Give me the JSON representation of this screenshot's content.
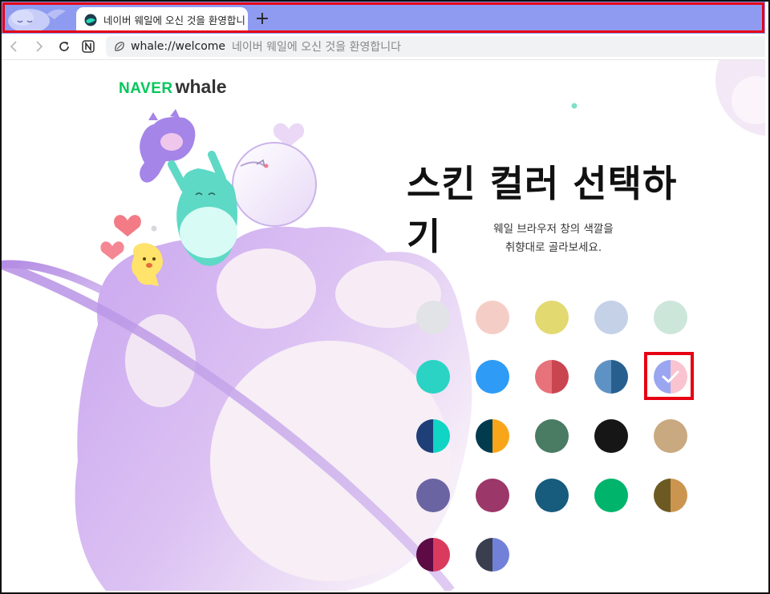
{
  "browser": {
    "tab_title": "네이버 웨일에 오신 것을 환영합니다",
    "new_tab_label": "+",
    "accent_color": "#8f9bf0"
  },
  "address_bar": {
    "url": "whale://welcome",
    "page_name": "네이버 웨일에 오신 것을 환영합니다"
  },
  "page": {
    "logo_naver": "NAVER",
    "logo_whale": "whale",
    "headline": "스킨 컬러 선택하기",
    "subtitle_line1": "웨일 브라우저 창의 색깔을",
    "subtitle_line2": "취향대로 골라보세요.",
    "selected_swatch_index": 9,
    "swatches": [
      {
        "left": "#e1e3e7",
        "right": "#e1e3e7"
      },
      {
        "left": "#f4cec6",
        "right": "#f4cec6"
      },
      {
        "left": "#e2d971",
        "right": "#e2d971"
      },
      {
        "left": "#c5d1e7",
        "right": "#c5d1e7"
      },
      {
        "left": "#cde6da",
        "right": "#cde6da"
      },
      {
        "left": "#2ad3c3",
        "right": "#2ad3c3"
      },
      {
        "left": "#2e9bf6",
        "right": "#2e9bf6"
      },
      {
        "left": "#e7727a",
        "right": "#c94651"
      },
      {
        "left": "#5f92c4",
        "right": "#27608f"
      },
      {
        "left": "#9aa6ef",
        "right": "#f9c3cf"
      },
      {
        "left": "#1e3f78",
        "right": "#10d4c4"
      },
      {
        "left": "#023b4e",
        "right": "#f9a51a"
      },
      {
        "left": "#4a7b63",
        "right": "#4a7b63"
      },
      {
        "left": "#161616",
        "right": "#161616"
      },
      {
        "left": "#c9a97f",
        "right": "#c9a97f"
      },
      {
        "left": "#6b64a3",
        "right": "#6b64a3"
      },
      {
        "left": "#9c376a",
        "right": "#9c376a"
      },
      {
        "left": "#175b7d",
        "right": "#175b7d"
      },
      {
        "left": "#00b46c",
        "right": "#00b46c"
      },
      {
        "left": "#6c5a22",
        "right": "#cb9550"
      },
      {
        "left": "#5d0a45",
        "right": "#d93a5e"
      },
      {
        "left": "#3a3f4f",
        "right": "#7281d8"
      }
    ]
  }
}
